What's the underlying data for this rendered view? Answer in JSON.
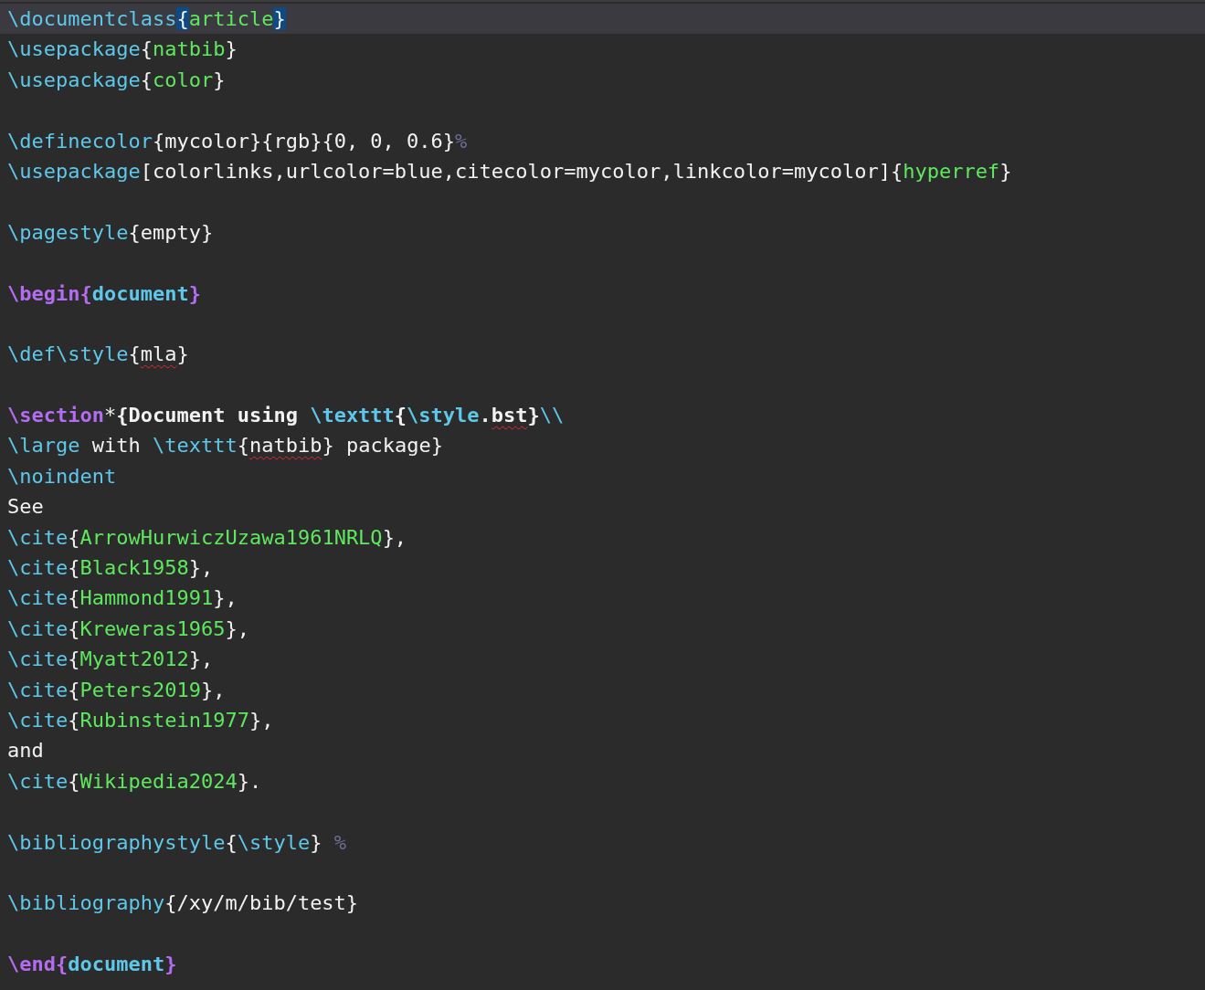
{
  "editor": {
    "lines": [
      {
        "kind": "code",
        "current": true,
        "tokens": [
          {
            "kind": "command",
            "text": "\\documentclass"
          },
          {
            "kind": "text",
            "text": "{",
            "match": true
          },
          {
            "kind": "argument",
            "text": "article"
          },
          {
            "kind": "text",
            "text": "}",
            "match": true
          }
        ]
      },
      {
        "kind": "code",
        "tokens": [
          {
            "kind": "command",
            "text": "\\usepackage"
          },
          {
            "kind": "text",
            "text": "{"
          },
          {
            "kind": "argument",
            "text": "natbib"
          },
          {
            "kind": "text",
            "text": "}"
          }
        ]
      },
      {
        "kind": "code",
        "tokens": [
          {
            "kind": "command",
            "text": "\\usepackage"
          },
          {
            "kind": "text",
            "text": "{"
          },
          {
            "kind": "argument",
            "text": "color"
          },
          {
            "kind": "text",
            "text": "}"
          }
        ]
      },
      {
        "kind": "blank"
      },
      {
        "kind": "code",
        "tokens": [
          {
            "kind": "command",
            "text": "\\definecolor"
          },
          {
            "kind": "text",
            "text": "{mycolor}{rgb}{0, 0, 0.6}"
          },
          {
            "kind": "comment",
            "text": "%"
          }
        ]
      },
      {
        "kind": "code",
        "tokens": [
          {
            "kind": "command",
            "text": "\\usepackage"
          },
          {
            "kind": "text",
            "text": "[colorlinks,urlcolor=blue,citecolor=mycolor,linkcolor=mycolor]{"
          },
          {
            "kind": "argument",
            "text": "hyperref"
          },
          {
            "kind": "text",
            "text": "}"
          }
        ]
      },
      {
        "kind": "blank"
      },
      {
        "kind": "code",
        "tokens": [
          {
            "kind": "command",
            "text": "\\pagestyle"
          },
          {
            "kind": "text",
            "text": "{empty}"
          }
        ]
      },
      {
        "kind": "blank"
      },
      {
        "kind": "code",
        "tokens": [
          {
            "kind": "keyword",
            "text": "\\begin{"
          },
          {
            "kind": "environment",
            "text": "document"
          },
          {
            "kind": "keyword",
            "text": "}"
          }
        ]
      },
      {
        "kind": "blank"
      },
      {
        "kind": "code",
        "tokens": [
          {
            "kind": "command",
            "text": "\\def\\style"
          },
          {
            "kind": "text",
            "text": "{"
          },
          {
            "kind": "text",
            "text": "mla",
            "misspelled": true
          },
          {
            "kind": "text",
            "text": "}"
          }
        ]
      },
      {
        "kind": "blank"
      },
      {
        "kind": "code",
        "tokens": [
          {
            "kind": "keyword",
            "text": "\\section"
          },
          {
            "kind": "text",
            "text": "*"
          },
          {
            "kind": "text",
            "text": "{Document using ",
            "bold": true
          },
          {
            "kind": "command",
            "text": "\\texttt",
            "bold": true
          },
          {
            "kind": "text",
            "text": "{",
            "bold": true
          },
          {
            "kind": "command",
            "text": "\\style",
            "bold": true
          },
          {
            "kind": "text",
            "text": ".",
            "bold": true
          },
          {
            "kind": "text",
            "text": "bst",
            "bold": true,
            "misspelled": true
          },
          {
            "kind": "text",
            "text": "}",
            "bold": true
          },
          {
            "kind": "command",
            "text": "\\\\"
          }
        ]
      },
      {
        "kind": "code",
        "tokens": [
          {
            "kind": "command",
            "text": "\\large"
          },
          {
            "kind": "text",
            "text": " with "
          },
          {
            "kind": "command",
            "text": "\\texttt"
          },
          {
            "kind": "text",
            "text": "{"
          },
          {
            "kind": "text",
            "text": "natbib",
            "misspelled": true
          },
          {
            "kind": "text",
            "text": "} package}"
          }
        ]
      },
      {
        "kind": "code",
        "tokens": [
          {
            "kind": "command",
            "text": "\\noindent"
          }
        ]
      },
      {
        "kind": "code",
        "tokens": [
          {
            "kind": "text",
            "text": "See"
          }
        ]
      },
      {
        "kind": "code",
        "tokens": [
          {
            "kind": "command",
            "text": "\\cite"
          },
          {
            "kind": "text",
            "text": "{"
          },
          {
            "kind": "argument",
            "text": "ArrowHurwiczUzawa1961NRLQ"
          },
          {
            "kind": "text",
            "text": "},"
          }
        ]
      },
      {
        "kind": "code",
        "tokens": [
          {
            "kind": "command",
            "text": "\\cite"
          },
          {
            "kind": "text",
            "text": "{"
          },
          {
            "kind": "argument",
            "text": "Black1958"
          },
          {
            "kind": "text",
            "text": "},"
          }
        ]
      },
      {
        "kind": "code",
        "tokens": [
          {
            "kind": "command",
            "text": "\\cite"
          },
          {
            "kind": "text",
            "text": "{"
          },
          {
            "kind": "argument",
            "text": "Hammond1991"
          },
          {
            "kind": "text",
            "text": "},"
          }
        ]
      },
      {
        "kind": "code",
        "tokens": [
          {
            "kind": "command",
            "text": "\\cite"
          },
          {
            "kind": "text",
            "text": "{"
          },
          {
            "kind": "argument",
            "text": "Kreweras1965"
          },
          {
            "kind": "text",
            "text": "},"
          }
        ]
      },
      {
        "kind": "code",
        "tokens": [
          {
            "kind": "command",
            "text": "\\cite"
          },
          {
            "kind": "text",
            "text": "{"
          },
          {
            "kind": "argument",
            "text": "Myatt2012"
          },
          {
            "kind": "text",
            "text": "},"
          }
        ]
      },
      {
        "kind": "code",
        "tokens": [
          {
            "kind": "command",
            "text": "\\cite"
          },
          {
            "kind": "text",
            "text": "{"
          },
          {
            "kind": "argument",
            "text": "Peters2019"
          },
          {
            "kind": "text",
            "text": "},"
          }
        ]
      },
      {
        "kind": "code",
        "tokens": [
          {
            "kind": "command",
            "text": "\\cite"
          },
          {
            "kind": "text",
            "text": "{"
          },
          {
            "kind": "argument",
            "text": "Rubinstein1977"
          },
          {
            "kind": "text",
            "text": "},"
          }
        ]
      },
      {
        "kind": "code",
        "tokens": [
          {
            "kind": "text",
            "text": "and"
          }
        ]
      },
      {
        "kind": "code",
        "tokens": [
          {
            "kind": "command",
            "text": "\\cite"
          },
          {
            "kind": "text",
            "text": "{"
          },
          {
            "kind": "argument",
            "text": "Wikipedia2024"
          },
          {
            "kind": "text",
            "text": "}."
          }
        ]
      },
      {
        "kind": "blank"
      },
      {
        "kind": "code",
        "tokens": [
          {
            "kind": "command",
            "text": "\\bibliographystyle"
          },
          {
            "kind": "text",
            "text": "{"
          },
          {
            "kind": "command",
            "text": "\\style"
          },
          {
            "kind": "text",
            "text": "} "
          },
          {
            "kind": "comment",
            "text": "%"
          }
        ]
      },
      {
        "kind": "blank"
      },
      {
        "kind": "code",
        "tokens": [
          {
            "kind": "command",
            "text": "\\bibliography"
          },
          {
            "kind": "text",
            "text": "{/xy/m/bib/test}"
          }
        ]
      },
      {
        "kind": "blank"
      },
      {
        "kind": "code",
        "tokens": [
          {
            "kind": "keyword",
            "text": "\\end{"
          },
          {
            "kind": "environment",
            "text": "document"
          },
          {
            "kind": "keyword",
            "text": "}"
          }
        ]
      }
    ]
  }
}
